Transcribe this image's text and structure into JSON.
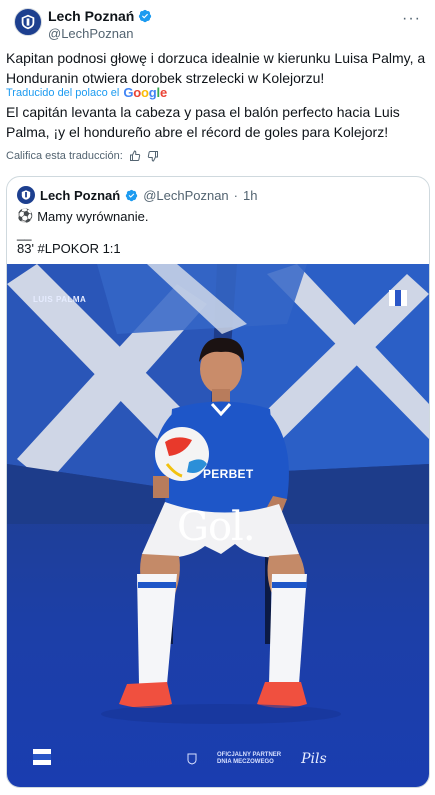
{
  "tweet": {
    "author": {
      "display_name": "Lech Poznań",
      "handle": "@LechPoznan",
      "verified": true,
      "avatar_icon": "lech-crest-icon"
    },
    "more_label": "···",
    "text": "Kapitan podnosi głowę i dorzuca idealnie w kierunku Luisa Palmy, a Honduranin otwiera dorobek strzelecki w Kolejorzu!",
    "translated_by_label": "Traducido del polaco el",
    "translation": "El capitán levanta la cabeza y pasa el balón perfecto hacia Luis Palma, ¡y el hondureño abre el récord de goles para Kolejorz!",
    "rate_label": "Califica esta traducción:"
  },
  "quoted_tweet": {
    "display_name": "Lech Poznań",
    "handle": "@LechPoznan",
    "separator": "·",
    "time": "1h",
    "line1": "Mamy wyrównanie.",
    "line2": "__",
    "line3": "83' #LPOKOR 1:1",
    "media": {
      "player_label": "LUIS PALMA",
      "sponsor": "PERBET",
      "headline": "Gol.",
      "partner_label_1": "OFICJALNY PARTNER",
      "partner_label_2": "DNIA MECZOWEGO",
      "script_logo": "Pils"
    }
  },
  "colors": {
    "accent": "#1d9bf0",
    "lech_blue": "#1d3f8f",
    "verified_blue": "#1d9bf0"
  }
}
